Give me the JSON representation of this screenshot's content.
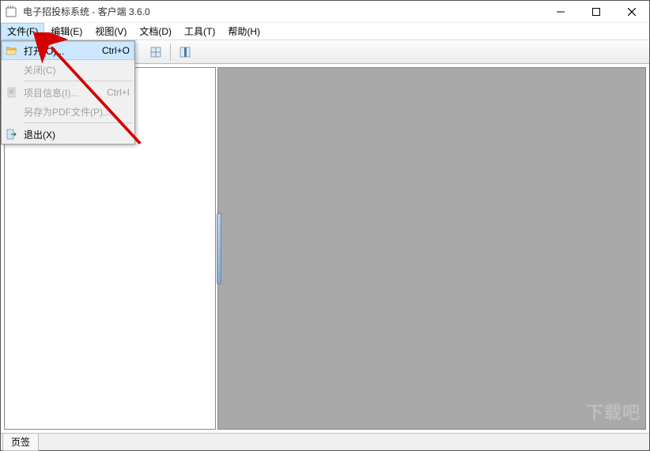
{
  "window": {
    "title": "电子招投标系统 - 客户端 3.6.0"
  },
  "menubar": {
    "items": [
      "文件(F)",
      "编辑(E)",
      "视图(V)",
      "文档(D)",
      "工具(T)",
      "帮助(H)"
    ]
  },
  "file_menu": {
    "open": {
      "label": "打开(O)...",
      "shortcut": "Ctrl+O"
    },
    "close": {
      "label": "关闭(C)"
    },
    "info": {
      "label": "项目信息(I)...",
      "shortcut": "Ctrl+I"
    },
    "savepdf": {
      "label": "另存为PDF文件(P)..."
    },
    "exit": {
      "label": "退出(X)"
    }
  },
  "statusbar": {
    "tab_label": "页签"
  },
  "watermark": "下载吧"
}
